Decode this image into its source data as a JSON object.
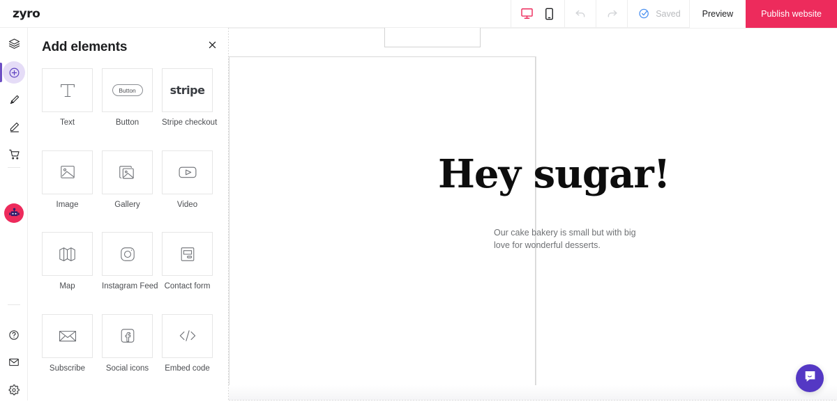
{
  "app": {
    "logo_text": "zyro"
  },
  "topbar": {
    "devices": [
      {
        "name": "desktop-view-icon",
        "label": "Desktop view",
        "active": true
      },
      {
        "name": "mobile-view-icon",
        "label": "Mobile view",
        "active": false
      }
    ],
    "undo_label": "Undo",
    "redo_label": "Redo",
    "saved_label": "Saved",
    "preview_label": "Preview",
    "publish_label": "Publish website",
    "accent_color": "#ed2b5c",
    "saved_icon_color": "#4a90f0"
  },
  "sidebar": {
    "items": [
      {
        "icon": "layers-icon",
        "label": "Pages",
        "active": false
      },
      {
        "icon": "plus-circle-icon",
        "label": "Add elements",
        "active": true
      },
      {
        "icon": "brush-icon",
        "label": "Styles",
        "active": false
      },
      {
        "icon": "pen-icon",
        "label": "Blog",
        "active": false
      },
      {
        "icon": "cart-icon",
        "label": "Online store",
        "active": false
      },
      {
        "icon": "robot-icon",
        "label": "AI assistant",
        "active": false
      },
      {
        "icon": "help-circle-icon",
        "label": "Help",
        "active": false
      },
      {
        "icon": "mail-icon",
        "label": "Messages",
        "active": false
      },
      {
        "icon": "gear-icon",
        "label": "Settings",
        "active": false
      }
    ],
    "active_highlight_color": "#e5dcf7",
    "active_indicator_color": "#6d4fc4",
    "robot_badge_color": "#ed2b5c"
  },
  "panel": {
    "title": "Add elements",
    "close_label": "×",
    "elements": [
      {
        "label": "Text",
        "icon": "text-icon"
      },
      {
        "label": "Button",
        "icon": "button-icon",
        "chip_text": "Button"
      },
      {
        "label": "Stripe checkout",
        "icon": "stripe-icon",
        "wordmark": "stripe"
      },
      {
        "label": "Image",
        "icon": "image-icon"
      },
      {
        "label": "Gallery",
        "icon": "gallery-icon"
      },
      {
        "label": "Video",
        "icon": "video-icon"
      },
      {
        "label": "Map",
        "icon": "map-icon"
      },
      {
        "label": "Instagram Feed",
        "icon": "instagram-icon"
      },
      {
        "label": "Contact form",
        "icon": "contact-form-icon"
      },
      {
        "label": "Subscribe",
        "icon": "envelope-icon"
      },
      {
        "label": "Social icons",
        "icon": "facebook-icon"
      },
      {
        "label": "Embed code",
        "icon": "code-icon"
      }
    ]
  },
  "canvas": {
    "hero_heading": "Hey sugar!",
    "hero_body": "Our cake bakery is small but with big love for wonderful desserts."
  },
  "intercom": {
    "label": "Open chat",
    "icon": "chat-bubble-icon",
    "color": "#5438c4"
  }
}
